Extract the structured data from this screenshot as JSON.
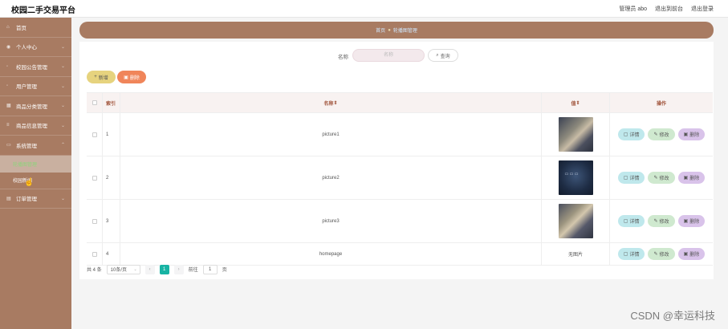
{
  "header": {
    "brand": "校园二手交易平台",
    "user_label": "管理员 abo",
    "exit_front": "退出到前台",
    "logout": "退出登录"
  },
  "sidebar": {
    "items": [
      {
        "label": "首页",
        "icon": "home-icon"
      },
      {
        "label": "个人中心",
        "icon": "user-icon"
      },
      {
        "label": "校园公告管理",
        "icon": "bell-icon"
      },
      {
        "label": "用户管理",
        "icon": "users-icon"
      },
      {
        "label": "商品分类管理",
        "icon": "category-icon"
      },
      {
        "label": "商品信息管理",
        "icon": "goods-icon"
      },
      {
        "label": "系统管理",
        "icon": "system-icon"
      }
    ],
    "sub_items": [
      {
        "label": "轮播图管理",
        "active": true
      },
      {
        "label": "校园新闻",
        "active": false
      }
    ],
    "after": {
      "label": "订单管理",
      "icon": "order-icon"
    }
  },
  "breadcrumb": {
    "home": "首页",
    "current": "轮播图管理"
  },
  "search": {
    "label": "名称",
    "placeholder": "名称",
    "button": "查询"
  },
  "actions": {
    "add": "新增",
    "delete": "删除"
  },
  "table": {
    "columns": [
      "索引",
      "名称",
      "值",
      "操作"
    ],
    "rows": [
      {
        "index": "1",
        "name": "picture1",
        "value": "",
        "thumb": "p1"
      },
      {
        "index": "2",
        "name": "picture2",
        "value": "",
        "thumb": "p2"
      },
      {
        "index": "3",
        "name": "picture3",
        "value": "",
        "thumb": "p3"
      },
      {
        "index": "4",
        "name": "homepage",
        "value": "无图片",
        "thumb": ""
      }
    ],
    "ops": {
      "detail": "详情",
      "edit": "修改",
      "remove": "删除"
    }
  },
  "pager": {
    "total": "共 4 条",
    "page_size": "10条/页",
    "current": "1",
    "goto_label": "前往",
    "goto_value": "1",
    "page_unit": "页"
  },
  "watermark": "CSDN @幸运科技"
}
